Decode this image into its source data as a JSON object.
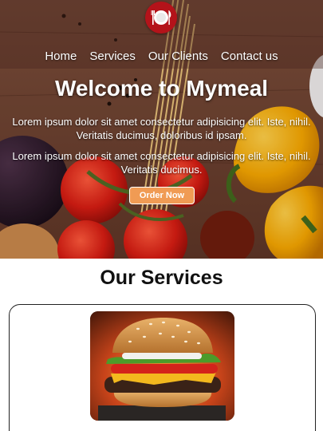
{
  "brand": {
    "logo_icon": "plate-fork-knife-icon",
    "logo_color": "#b4131a"
  },
  "nav": {
    "items": [
      {
        "label": "Home"
      },
      {
        "label": "Services"
      },
      {
        "label": "Our Clients"
      },
      {
        "label": "Contact us"
      }
    ]
  },
  "hero": {
    "title": "Welcome to Mymeal",
    "paragraph1": "Lorem ipsum dolor sit amet consectetur adipisicing elit. Iste, nihil. Veritatis ducimus, doloribus id ipsam.",
    "paragraph2": "Lorem ipsum dolor sit amet consectetur adipisicing elit. Iste, nihil. Veritatis ducimus.",
    "button_label": "Order Now",
    "button_color": "#f09b54"
  },
  "services": {
    "title": "Our Services",
    "cards": [
      {
        "image": "burger-photo"
      }
    ]
  }
}
